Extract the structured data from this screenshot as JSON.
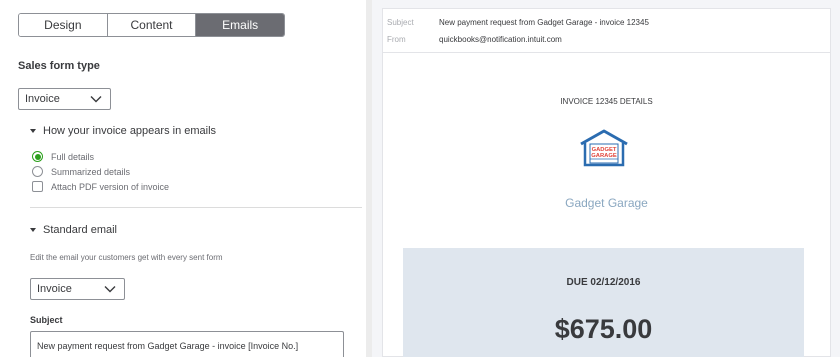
{
  "tabs": [
    {
      "label": "Design",
      "active": false
    },
    {
      "label": "Content",
      "active": false
    },
    {
      "label": "Emails",
      "active": true
    }
  ],
  "sales_form": {
    "title": "Sales form type",
    "selected": "Invoice"
  },
  "appearance": {
    "heading": "How your invoice appears in emails",
    "options": [
      {
        "label": "Full details",
        "type": "radio",
        "selected": true
      },
      {
        "label": "Summarized details",
        "type": "radio",
        "selected": false
      },
      {
        "label": "Attach PDF version of invoice",
        "type": "checkbox",
        "checked": false
      }
    ]
  },
  "standard_email": {
    "heading": "Standard email",
    "help": "Edit the email your customers get with every sent form",
    "form_selected": "Invoice",
    "subject_label": "Subject",
    "subject_value": "New payment request from Gadget Garage - invoice [Invoice No.]"
  },
  "preview": {
    "header": {
      "subject_label": "Subject",
      "subject_value": "New payment request from Gadget Garage - invoice 12345",
      "from_label": "From",
      "from_value": "quickbooks@notification.intuit.com"
    },
    "invoice_details": "INVOICE 12345 DETAILS",
    "logo_text_line1": "GADGET",
    "logo_text_line2": "GARAGE",
    "company_name": "Gadget Garage",
    "due_label": "DUE 02/12/2016",
    "amount": "$675.00"
  },
  "colors": {
    "accent_green": "#2ca01c",
    "tab_active": "#6b6c72",
    "preview_bg": "#f4f5f8",
    "due_card": "#dfe6ee",
    "company_text": "#8aa7c0",
    "logo_blue": "#2b6cb0",
    "logo_red": "#e0443a"
  }
}
